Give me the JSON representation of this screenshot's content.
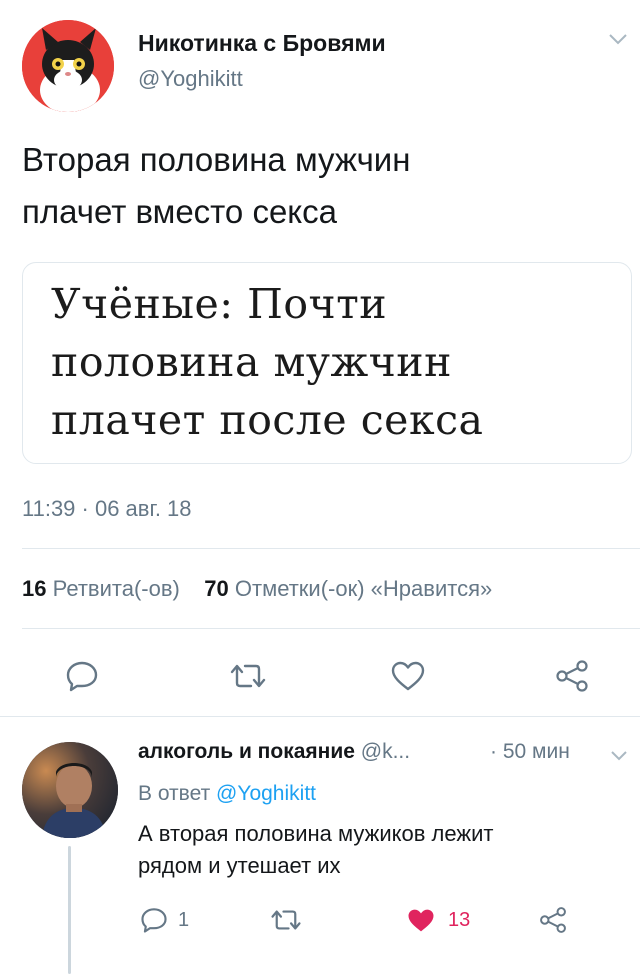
{
  "tweet": {
    "author_name": "Никотинка с Бровями",
    "author_handle": "@Yoghikitt",
    "text_line1": "Вторая половина мужчин",
    "text_line2": "плачет вместо секса",
    "quote_line1": "Учёные: Почти",
    "quote_line2": "половина мужчин",
    "quote_line3": "плачет после секса",
    "timestamp": "11:39 · 06 авг. 18",
    "retweets_count": "16",
    "retweets_label": "Ретвита(-ов)",
    "likes_count": "70",
    "likes_label": "Отметки(-ок) «Нравится»"
  },
  "reply": {
    "author_name": "алкоголь и покаяние",
    "author_handle": "@k...",
    "time": "· 50 мин",
    "in_reply_prefix": "В ответ ",
    "in_reply_handle": "@Yoghikitt",
    "text_line1": "А вторая половина мужиков лежит",
    "text_line2": "рядом и утешает их",
    "reply_count": "1",
    "like_count": "13"
  },
  "colors": {
    "accent": "#1da1f2",
    "like_red": "#e0245e",
    "muted": "#657786",
    "icon": "#657786",
    "divider": "#e1e8ed"
  },
  "icons": [
    "reply-icon",
    "retweet-icon",
    "like-icon",
    "share-icon",
    "chevron-down-icon"
  ]
}
